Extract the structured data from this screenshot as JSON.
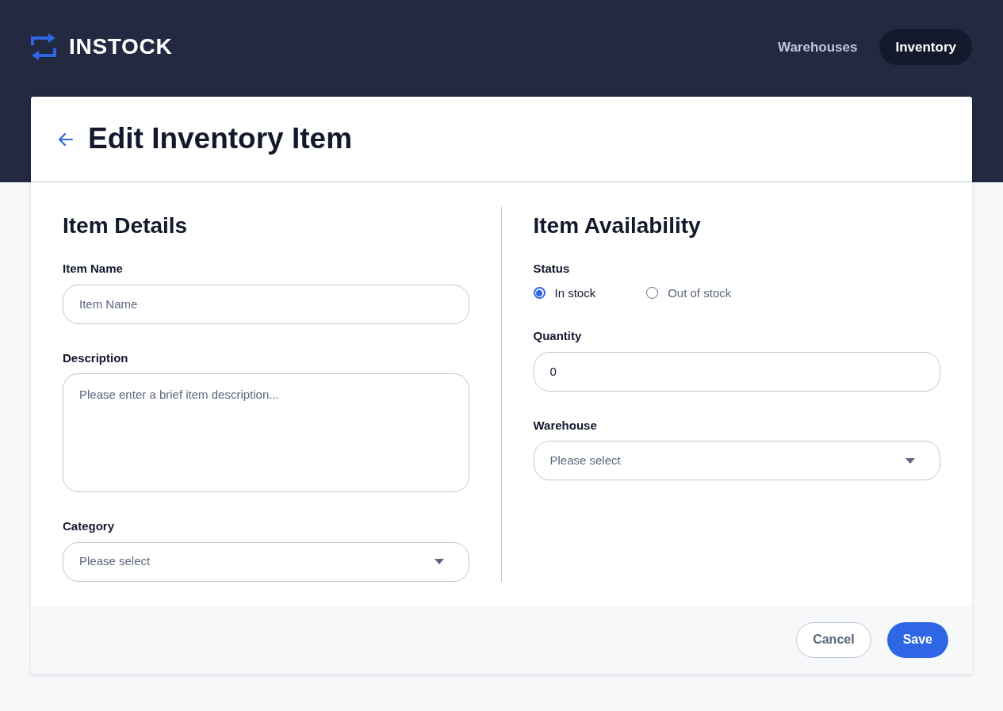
{
  "header": {
    "logo": "INSTOCK",
    "nav": [
      {
        "label": "Warehouses",
        "selected": false
      },
      {
        "label": "Inventory",
        "selected": true
      }
    ]
  },
  "page": {
    "title": "Edit Inventory Item"
  },
  "details": {
    "heading": "Item Details",
    "fields": [
      {
        "kind": "text",
        "label": "Item Name",
        "placeholder": "Item Name"
      },
      {
        "kind": "textarea",
        "label": "Description",
        "placeholder": "Please enter a brief item description..."
      },
      {
        "kind": "select",
        "label": "Category",
        "placeholder": "Please select"
      }
    ]
  },
  "availability": {
    "heading": "Item Availability",
    "status": {
      "label": "Status",
      "options": [
        {
          "label": "In stock",
          "selected": true
        },
        {
          "label": "Out of stock",
          "selected": false
        }
      ]
    },
    "fields": [
      {
        "kind": "text",
        "label": "Quantity",
        "value": "0"
      },
      {
        "kind": "select",
        "label": "Warehouse",
        "placeholder": "Please select"
      }
    ]
  },
  "buttons": [
    {
      "kind": "secondary",
      "label": "Cancel"
    },
    {
      "kind": "primary",
      "label": "Save"
    }
  ]
}
